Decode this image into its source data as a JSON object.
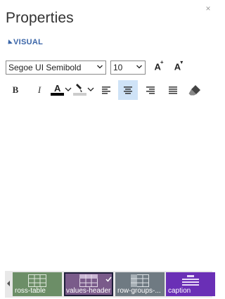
{
  "panel": {
    "title": "Properties",
    "close_label": "×",
    "section_label": "VISUAL"
  },
  "font": {
    "family_value": "Segoe UI Semibold",
    "size_value": "10",
    "grow_label": "A",
    "shrink_label": "A"
  },
  "format_toolbar": {
    "bold_label": "B",
    "italic_label": "I",
    "font_color_label": "A",
    "font_color": "#000000",
    "highlight_color": "#cccccc",
    "active_alignment": "center",
    "active_bg": "#cfe3f7"
  },
  "styles": {
    "items": [
      {
        "label": "ross-table",
        "color": "#6c8e67",
        "selected": false
      },
      {
        "label": "values-header",
        "color": "#7a5b8a",
        "selected": true
      },
      {
        "label": "row-groups-...",
        "color": "#6f7a82",
        "selected": false
      },
      {
        "label": "caption",
        "color": "#6a2fb6",
        "selected": false
      }
    ]
  }
}
